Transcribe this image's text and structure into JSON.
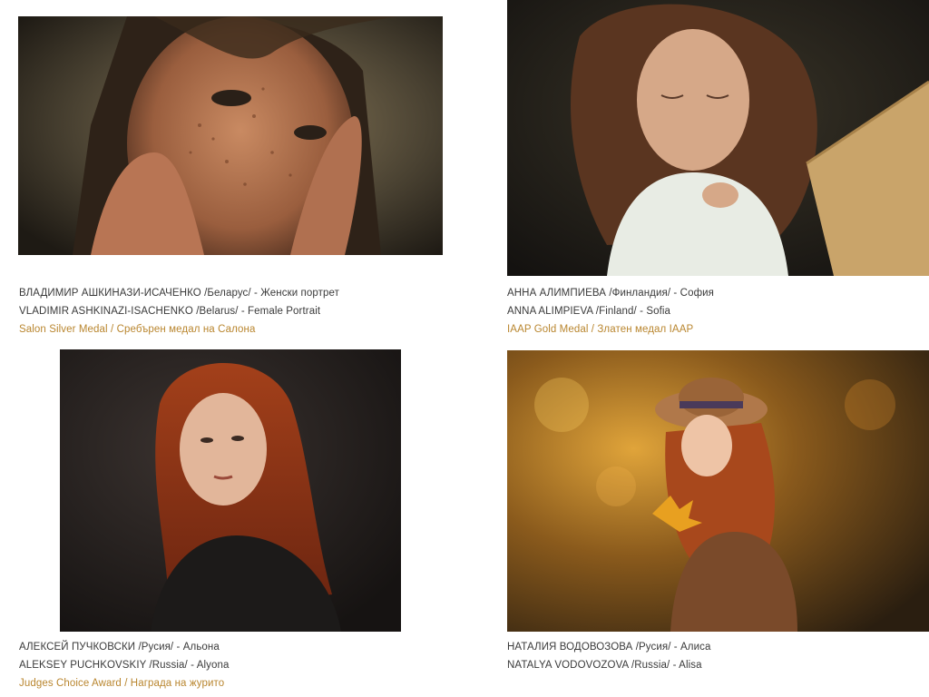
{
  "entries": [
    {
      "line_bg": "ВЛАДИМИР АШКИНАЗИ-ИСАЧЕНКО /Беларус/ - Женски портрет",
      "line_en": "VLADIMIR ASHKINAZI-ISACHENKO /Belarus/ - Female Portrait",
      "award": "Salon Silver Medal / Сребърен медал на Салона"
    },
    {
      "line_bg": "АННА АЛИМПИЕВА /Финландия/ - София",
      "line_en": "ANNA ALIMPIEVA /Finland/ - Sofia",
      "award": "IAAP Gold Medal / Златен медал IAAP"
    },
    {
      "line_bg": "АЛЕКСЕЙ ПУЧКОВСКИ /Русия/ - Альона",
      "line_en": "ALEKSEY PUCHKOVSKIY /Russia/ - Alyona",
      "award": "Judges Choice Award / Награда на журито"
    },
    {
      "line_bg": "НАТАЛИЯ ВОДОВОЗОВА /Русия/ - Алиса",
      "line_en": "NATALYA VODOVOZOVA /Russia/ - Alisa"
    }
  ],
  "colors": {
    "award_text": "#b9862f",
    "caption_text": "#3a3a3a"
  }
}
